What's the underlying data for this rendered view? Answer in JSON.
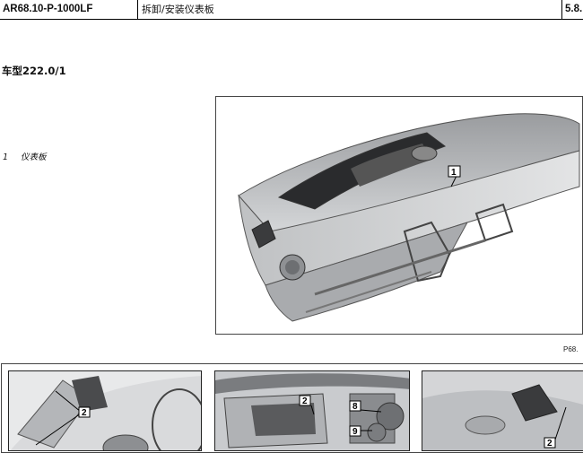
{
  "header": {
    "doc_code": "AR68.10-P-1000LF",
    "title": "拆卸/安装仪表板",
    "page": "5.8."
  },
  "model_label": "车型222.0/1",
  "legend": [
    {
      "num": "1",
      "text": "仪表板"
    }
  ],
  "main_figure": {
    "callout": "1",
    "ref": "P68."
  },
  "thumbnails": [
    {
      "callouts": [
        "2"
      ]
    },
    {
      "callouts": [
        "2",
        "8",
        "9"
      ]
    },
    {
      "callouts": [
        "2"
      ]
    }
  ]
}
